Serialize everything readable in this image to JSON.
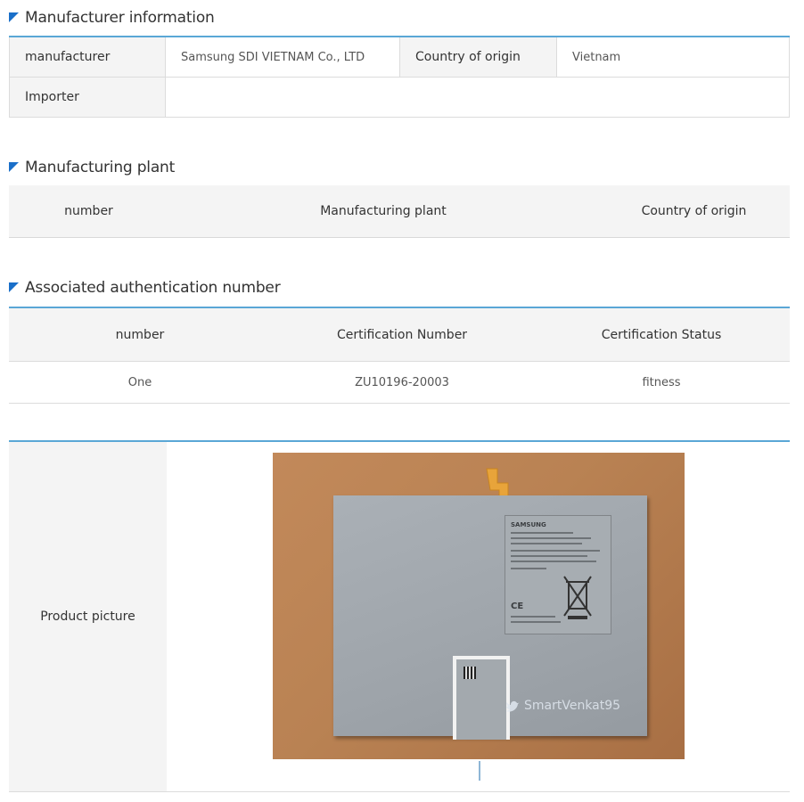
{
  "sections": {
    "manufacturer_info": "Manufacturer information",
    "manufacturing_plant": "Manufacturing plant",
    "auth_number": "Associated authentication number"
  },
  "manufacturer": {
    "manufacturer_label": "manufacturer",
    "manufacturer_value": "Samsung SDI VIETNAM Co., LTD",
    "origin_label": "Country of origin",
    "origin_value": "Vietnam",
    "importer_label": "Importer",
    "importer_value": ""
  },
  "plant": {
    "headers": [
      "number",
      "Manufacturing plant",
      "Country of origin"
    ]
  },
  "certification": {
    "headers": [
      "number",
      "Certification Number",
      "Certification Status"
    ],
    "rows": [
      [
        "One",
        "ZU10196-20003",
        "fitness"
      ]
    ]
  },
  "product": {
    "label": "Product picture",
    "brand_text": "SAMSUNG",
    "ce_text": "CE",
    "watermark": "SmartVenkat95"
  },
  "colors": {
    "accent": "#1a6fc9",
    "rule": "#5aa7d6",
    "header_bg": "#f4f4f4"
  }
}
